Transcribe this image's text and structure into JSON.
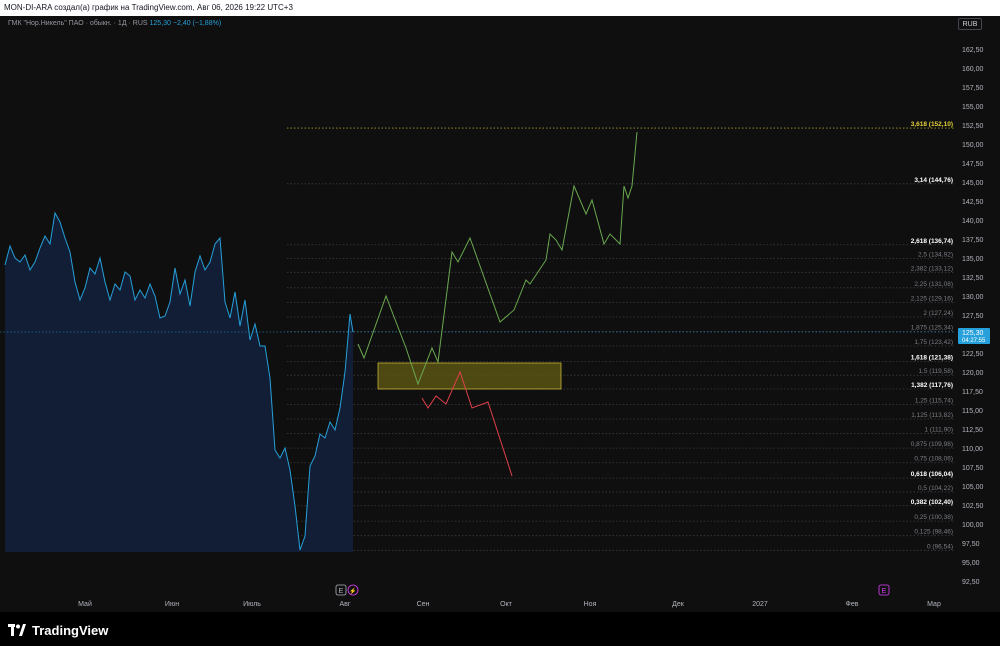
{
  "topbar": {
    "caption": "MON-DI-ARA создал(а) график на TradingView.com, Авг 06, 2026 19:22 UTC+3"
  },
  "legend": {
    "symbol": "ГМК \"Нор.Никель\" ПАО · обыкн. · 1Д · RUS",
    "price": "125,30",
    "change": "−2,40 (−1,88%)"
  },
  "currency": "RUB",
  "price_scale": [
    "162,50",
    "160,00",
    "157,50",
    "155,00",
    "152,50",
    "150,00",
    "147,50",
    "145,00",
    "142,50",
    "140,00",
    "137,50",
    "135,00",
    "132,50",
    "130,00",
    "127,50",
    "125,00",
    "122,50",
    "120,00",
    "117,50",
    "115,00",
    "112,50",
    "110,00",
    "107,50",
    "105,00",
    "102,50",
    "100,00",
    "97,50",
    "95,00",
    "92,50"
  ],
  "current_price": {
    "value": "125,30",
    "countdown": "04:27:55"
  },
  "time_axis": [
    "Май",
    "Июн",
    "Июль",
    "Авг",
    "Сен",
    "Окт",
    "Ноя",
    "Дек",
    "2027",
    "Фев",
    "Мар"
  ],
  "fib_levels": [
    {
      "label": "3,618 (152,10)",
      "price": 152.1,
      "color": "#e6d23a",
      "bold": true
    },
    {
      "label": "3,14 (144,76)",
      "price": 144.76,
      "color": "#ffffff",
      "bold": true
    },
    {
      "label": "2,618 (136,74)",
      "price": 136.74,
      "color": "#ffffff",
      "bold": true
    },
    {
      "label": "2,5 (134,92)",
      "price": 134.92,
      "color": "#7a7d85",
      "bold": false
    },
    {
      "label": "2,382 (133,12)",
      "price": 133.12,
      "color": "#7a7d85",
      "bold": false
    },
    {
      "label": "2,25 (131,08)",
      "price": 131.08,
      "color": "#7a7d85",
      "bold": false
    },
    {
      "label": "2,125 (129,16)",
      "price": 129.16,
      "color": "#7a7d85",
      "bold": false
    },
    {
      "label": "2 (127,24)",
      "price": 127.24,
      "color": "#7a7d85",
      "bold": false
    },
    {
      "label": "1,875 (125,34)",
      "price": 125.34,
      "color": "#7a7d85",
      "bold": false
    },
    {
      "label": "1,75 (123,42)",
      "price": 123.42,
      "color": "#7a7d85",
      "bold": false
    },
    {
      "label": "1,618 (121,38)",
      "price": 121.38,
      "color": "#ffffff",
      "bold": true
    },
    {
      "label": "1,5 (119,58)",
      "price": 119.58,
      "color": "#7a7d85",
      "bold": false
    },
    {
      "label": "1,382 (117,76)",
      "price": 117.76,
      "color": "#ffffff",
      "bold": true
    },
    {
      "label": "1,25 (115,74)",
      "price": 115.74,
      "color": "#7a7d85",
      "bold": false
    },
    {
      "label": "1,125 (113,82)",
      "price": 113.82,
      "color": "#7a7d85",
      "bold": false
    },
    {
      "label": "1 (111,90)",
      "price": 111.9,
      "color": "#7a7d85",
      "bold": false
    },
    {
      "label": "0,875 (109,98)",
      "price": 109.98,
      "color": "#7a7d85",
      "bold": false
    },
    {
      "label": "0,75 (108,06)",
      "price": 108.06,
      "color": "#7a7d85",
      "bold": false
    },
    {
      "label": "0,618 (106,04)",
      "price": 106.04,
      "color": "#ffffff",
      "bold": true
    },
    {
      "label": "0,5 (104,22)",
      "price": 104.22,
      "color": "#7a7d85",
      "bold": false
    },
    {
      "label": "0,382 (102,40)",
      "price": 102.4,
      "color": "#ffffff",
      "bold": true
    },
    {
      "label": "0,25 (100,38)",
      "price": 100.38,
      "color": "#7a7d85",
      "bold": false
    },
    {
      "label": "0,125 (98,46)",
      "price": 98.46,
      "color": "#7a7d85",
      "bold": false
    },
    {
      "label": "0 (96,54)",
      "price": 96.54,
      "color": "#7a7d85",
      "bold": false
    }
  ],
  "markers": {
    "earnings": "E",
    "dividend": "⚡",
    "future_earnings": "E"
  },
  "colors": {
    "price_line": "#26a0da",
    "bull_path": "#6aa84f",
    "bear_path": "#e0404a",
    "zone": "#e6d23a",
    "current_label_bg": "#26a0da"
  },
  "footer": {
    "brand": "TradingView"
  }
}
